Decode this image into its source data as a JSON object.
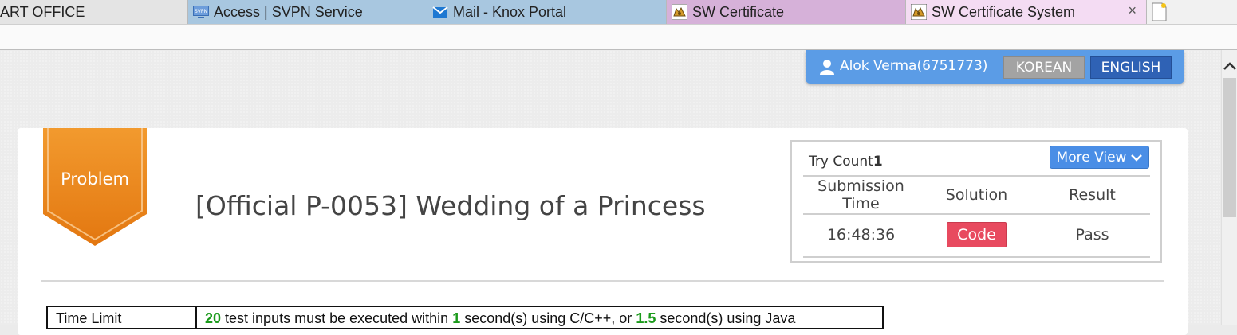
{
  "tabs": [
    {
      "label": "ART OFFICE",
      "bg": "#e4e4e4"
    },
    {
      "label": "Access | SVPN Service",
      "bg": "#a8c7e0",
      "icon": "svpn-icon",
      "icon_text": "SVPN"
    },
    {
      "label": "Mail - Knox Portal",
      "bg": "#a8c7e0",
      "icon": "mail-icon"
    },
    {
      "label": "SW Certificate",
      "bg": "#d6b1d9",
      "icon": "tomcat-icon"
    },
    {
      "label": "SW Certificate System",
      "bg": "#f4dcf3",
      "icon": "tomcat-icon",
      "close": "×"
    }
  ],
  "user": {
    "name": "Alok Verma(6751773)",
    "korean_label": "KOREAN",
    "english_label": "ENGLISH"
  },
  "problem": {
    "badge": "Problem",
    "title": "[Official P-0053] Wedding of a Princess"
  },
  "submission": {
    "try_count_label": "Try Count",
    "try_count": "1",
    "more_view_label": "More View",
    "headers": {
      "time": "Submission Time",
      "solution": "Solution",
      "result": "Result"
    },
    "rows": [
      {
        "time": "16:48:36",
        "solution": "Code",
        "result": "Pass"
      }
    ]
  },
  "info": {
    "time_limit_label": "Time Limit",
    "test_inputs": "20",
    "text_1": " test inputs must be executed within ",
    "cpp_seconds": "1",
    "text_2": " second(s) using C/C++, or ",
    "java_seconds": "1.5",
    "text_3": " second(s) using Java"
  },
  "colors": {
    "userbar": "#5b9ce6",
    "ribbon": "#f08a1e",
    "code_button": "#e84a5f",
    "more_view": "#4a8ee6",
    "highlight": "#1b9a1b"
  }
}
